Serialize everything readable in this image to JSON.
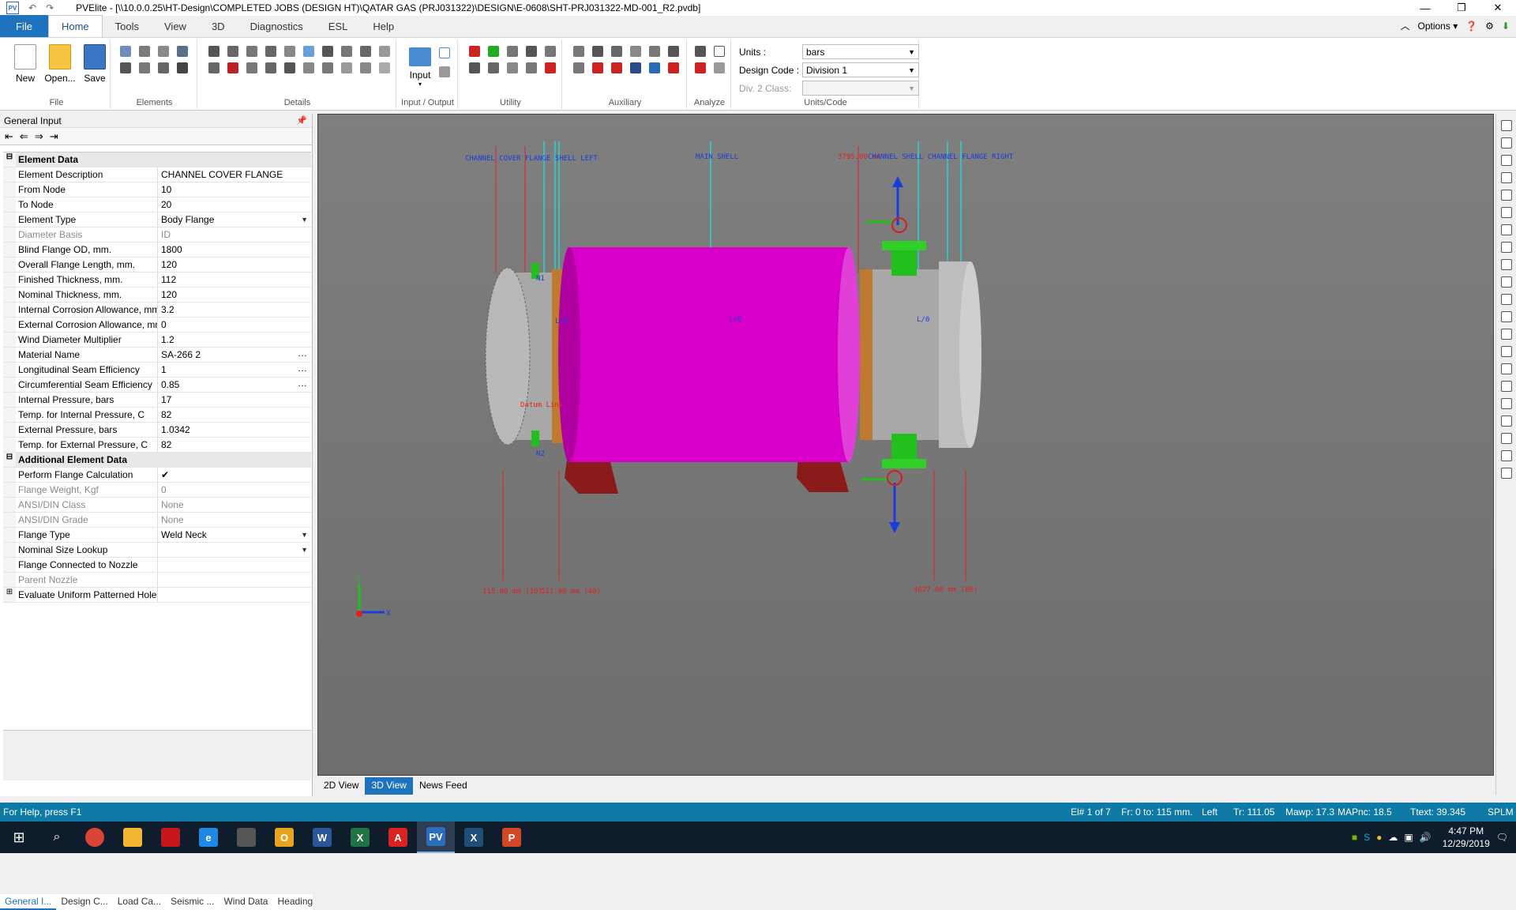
{
  "app": {
    "name": "PVElite",
    "title": "PVElite - [\\\\10.0.0.25\\HT-Design\\COMPLETED JOBS (DESIGN HT)\\QATAR GAS (PRJ031322)\\DESIGN\\E-0608\\SHT-PRJ031322-MD-001_R2.pvdb]",
    "icon_text": "PV",
    "options_label": "Options"
  },
  "menu": {
    "tabs": [
      "File",
      "Home",
      "Tools",
      "View",
      "3D",
      "Diagnostics",
      "ESL",
      "Help"
    ],
    "active": "Home"
  },
  "ribbon": {
    "file": {
      "new": "New",
      "open": "Open...",
      "save": "Save",
      "label": "File"
    },
    "elements_label": "Elements",
    "details_label": "Details",
    "io": {
      "input": "Input",
      "label": "Input / Output"
    },
    "utility_label": "Utility",
    "auxiliary_label": "Auxiliary",
    "analyze_label": "Analyze",
    "units": {
      "units_label": "Units :",
      "units_value": "bars",
      "design_code_label": "Design Code :",
      "design_code_value": "Division 1",
      "div2_label": "Div. 2 Class:",
      "div2_value": "",
      "label": "Units/Code"
    }
  },
  "panel": {
    "title": "General Input",
    "categories": [
      "Element Data",
      "Additional Element Data"
    ],
    "element_data": [
      {
        "label": "Element Description",
        "value": "CHANNEL COVER FLANGE"
      },
      {
        "label": "From Node",
        "value": "10"
      },
      {
        "label": "To Node",
        "value": "20"
      },
      {
        "label": "Element Type",
        "value": "Body Flange"
      },
      {
        "label": "Diameter Basis",
        "value": "ID"
      },
      {
        "label": "Blind Flange OD, mm.",
        "value": "1800"
      },
      {
        "label": "Overall Flange Length, mm.",
        "value": "120"
      },
      {
        "label": "Finished Thickness, mm.",
        "value": "112"
      },
      {
        "label": "Nominal Thickness, mm.",
        "value": "120"
      },
      {
        "label": "Internal Corrosion Allowance, mm",
        "value": "3.2"
      },
      {
        "label": "External Corrosion Allowance, mm",
        "value": "0"
      },
      {
        "label": "Wind Diameter Multiplier",
        "value": "1.2"
      },
      {
        "label": "Material Name",
        "value": "SA-266 2"
      },
      {
        "label": "Longitudinal Seam Efficiency",
        "value": "1"
      },
      {
        "label": "Circumferential Seam Efficiency",
        "value": "0.85"
      },
      {
        "label": "Internal Pressure, bars",
        "value": "17"
      },
      {
        "label": "Temp. for Internal Pressure, C",
        "value": "82"
      },
      {
        "label": "External Pressure, bars",
        "value": "1.0342"
      },
      {
        "label": "Temp. for External Pressure, C",
        "value": "82"
      }
    ],
    "additional_data": [
      {
        "label": "Perform Flange Calculation",
        "value": "✔"
      },
      {
        "label": "Flange Weight, Kgf",
        "value": "0"
      },
      {
        "label": "ANSI/DIN Class",
        "value": "None"
      },
      {
        "label": "ANSI/DIN Grade",
        "value": "None"
      },
      {
        "label": "Flange Type",
        "value": "Weld Neck"
      },
      {
        "label": "Nominal Size Lookup",
        "value": ""
      },
      {
        "label": "Flange Connected to Nozzle",
        "value": ""
      },
      {
        "label": "Parent Nozzle",
        "value": ""
      },
      {
        "label": "Evaluate Uniform Patterned Holes",
        "value": ""
      }
    ],
    "bottom_tabs": [
      "General I...",
      "Design C...",
      "Load Ca...",
      "Seismic ...",
      "Wind Data",
      "Heading"
    ]
  },
  "view": {
    "tabs": [
      "2D View",
      "3D View",
      "News Feed"
    ],
    "active": "3D View",
    "labels": {
      "left": "CHANNEL COVER FLANGE SHELL LEFT",
      "main": "MAIN SHELL",
      "right_dim": "3795.00 mm",
      "right": "CHANNEL SHELL CHANNEL FLANGE RIGHT",
      "datum": "Datum Line",
      "dim1": "115.00 mm  (10)",
      "dim2": "511.00 mm  (40)",
      "dim3": "4627.00 mm  (80)",
      "l1": "L/0",
      "l2": "L/0",
      "l3": "L/0",
      "n1": "N1",
      "n2": "N2",
      "axis_x": "X",
      "axis_y": "Y"
    }
  },
  "colors": {
    "shell": "#d800c8",
    "saddle": "#8b1a1a",
    "nozzle": "#22c01c",
    "flange": "#b9b9b9",
    "accent": "#1e73be",
    "statusbar": "#0e7aa5"
  },
  "status": {
    "help": "For Help, press F1",
    "el": "El# 1 of 7",
    "fr": "Fr: 0 to: 115 mm.",
    "side": "Left",
    "tr": "Tr: 111.05",
    "mawp": "Mawp: 17.3",
    "mapnc": "MAPnc: 18.5",
    "text": "Ttext: 39.345",
    "splm": "SPLM"
  },
  "taskbar": {
    "apps": [
      "Chrome",
      "File Explorer",
      "Acrobat",
      "Internet Explorer",
      "Photos",
      "Outlook",
      "Word",
      "Excel",
      "Acrobat Reader",
      "PVElite",
      "Xpress",
      "PowerPoint"
    ],
    "time": "4:47 PM",
    "date": "12/29/2019"
  }
}
